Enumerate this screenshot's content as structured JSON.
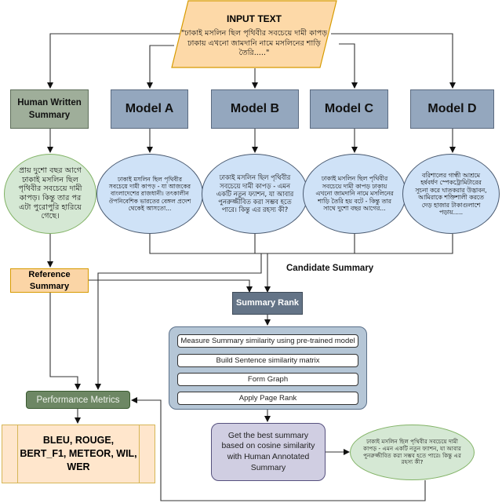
{
  "input": {
    "title": "INPUT TEXT",
    "text": "\"ঢাকাই মসলিন ছিল পৃথিবীর সবচেয়ে দামী কাপড় ঢাকায় এখনো জামদানি নামে মসলিনের শাড়ি তৈরি.....\""
  },
  "sources": [
    {
      "id": "human",
      "label": "Human Written Summary",
      "summary": "প্রায় দুশো বছর আগে ঢাকাই মসলিন ছিল পৃথিবীর সবচেয়ে দামী কাপড়। কিন্তু তার পর এটা পুরোপুরি হারিয়ে গেছে।"
    },
    {
      "id": "model-a",
      "label": "Model A",
      "summary": "ঢাকাই মসলিন ছিল পৃথিবীর সবচেয়ে দামী কাপড় - যা আজকের বাংলাদেশের রাজধানী। তৎকালীন ঔপনিবেশিক ভারতের বেঙ্গল প্রদেশ থেকেই আসতো..."
    },
    {
      "id": "model-b",
      "label": "Model B",
      "summary": "ঢাকাই মসলিন ছিল পৃথিবীর সবচেয়ে দামী কাপড় - এমন একটি নতুন ফ্যাশন, যা আবার পুনরুজ্জীবিত করা সম্ভব হতে পারে। কিন্তু এর রহস্য কী?"
    },
    {
      "id": "model-c",
      "label": "Model C",
      "summary": "ঢাকাই মসলিন ছিল পৃথিবীর সবচেয়ে দামী কাপড় ঢাকায় এখনো জামদানি নামে মসলিনের শাড়ি তৈরি হয় বটে - কিন্তু তার সাথে দুশো বছর আগের..."
    },
    {
      "id": "model-d",
      "label": "Model D",
      "summary": "বরিশালের গান্ধী আশ্রমে হর্ষবর্ধণ স্পেকট্রোমিটারের সূচনা করে ঘাতকরার উদ্ভাবন, আমিরাকে শক্তিশালী করতে দেড় হাজার টাকাগুলাশে পড়ায়....."
    }
  ],
  "labels": {
    "reference_summary": "Reference Summary",
    "candidate_summary": "Candidate Summary",
    "summary_rank": "Summary Rank",
    "performance_metrics": "Performance Metrics",
    "metrics_list": "BLEU, ROUGE, BERT_F1, METEOR, WIL, WER",
    "best_summary": "Get the best summary based on cosine similarity with Human Annotated Summary"
  },
  "rank_steps": [
    "Measure Summary similarity using pre-trained model",
    "Build Sentence similarity matrix",
    "Form Graph",
    "Apply Page Rank"
  ],
  "best_summary_output": "ঢাকাই মসলিন ছিল পৃথিবীর সবচেয়ে দামী কাপড় - এমন একটি নতুন ফ্যাশন, যা আবার পুনরুজ্জীবিত করা সম্ভব হতে পারে। কিন্তু এর রহস্য কী?",
  "colors": {
    "input_fill": "#fdd9a8",
    "model_fill": "#94a7be",
    "human_fill": "#9fae9a",
    "reference_fill": "#fbd5a6",
    "summary_rank_fill": "#647487",
    "perf_fill": "#6d8764",
    "metrics_fill": "#ffe6cc",
    "rank_container_fill": "#b5c6d6",
    "best_fill": "#d0cee2"
  }
}
